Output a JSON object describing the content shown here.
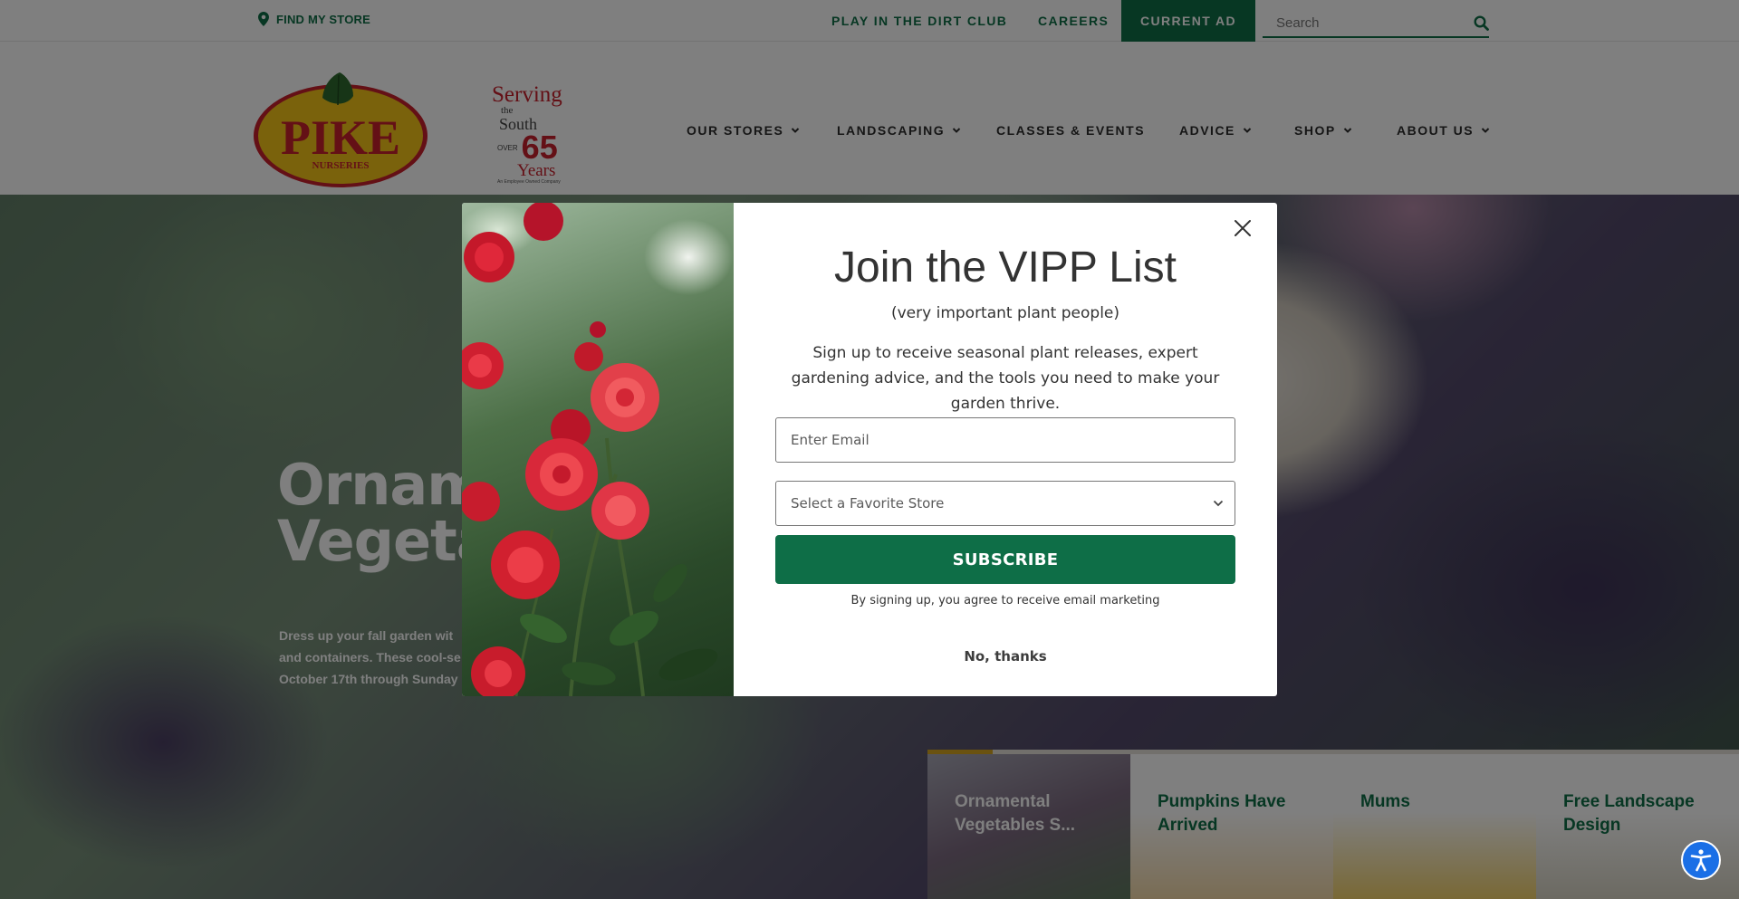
{
  "topbar": {
    "find_store": "FIND MY STORE",
    "links": [
      "PLAY IN THE DIRT CLUB",
      "CAREERS"
    ],
    "current_ad": "CURRENT AD",
    "search_placeholder": "Search"
  },
  "brand": {
    "logo_text": "PIKE",
    "logo_subtext": "NURSERIES",
    "anniversary": {
      "line1": "Serving",
      "line2": "the",
      "line3": "South",
      "over": "OVER",
      "number": "65",
      "years": "Years",
      "tagline": "An Employee Owned Company"
    }
  },
  "nav": {
    "items": [
      {
        "label": "OUR STORES",
        "dropdown": true
      },
      {
        "label": "LANDSCAPING",
        "dropdown": true
      },
      {
        "label": "CLASSES & EVENTS",
        "dropdown": false
      },
      {
        "label": "ADVICE",
        "dropdown": true
      },
      {
        "label": "SHOP",
        "dropdown": true
      },
      {
        "label": "ABOUT US",
        "dropdown": true
      }
    ]
  },
  "hero": {
    "title_line1": "Ornam",
    "title_line2": "Vegeta",
    "desc_line1": "Dress up your fall garden wit",
    "desc_line2": "and containers. These cool-se",
    "desc_line3": "October 17th through Sunday"
  },
  "tiles": [
    {
      "label": "Ornamental Vegetables S..."
    },
    {
      "label": "Pumpkins Have Arrived"
    },
    {
      "label": "Mums"
    },
    {
      "label": "Free Landscape Design"
    }
  ],
  "modal": {
    "title": "Join the VIPP List",
    "subtitle": "(very important plant people)",
    "description": "Sign up to receive seasonal plant releases, expert gardening advice, and the tools you need to make your garden thrive.",
    "email_placeholder": "Enter Email",
    "store_select": "Select a Favorite Store",
    "subscribe": "SUBSCRIBE",
    "legal": "By signing up, you agree to receive email marketing",
    "no_thanks": "No, thanks"
  },
  "colors": {
    "brand_green": "#0e6e47",
    "accent_gold": "#d5a520",
    "logo_red": "#c8202d",
    "logo_yellow": "#f5c518",
    "a11y_blue": "#1a6fe6"
  },
  "icons": [
    "map-pin-icon",
    "search-icon",
    "chevron-down-icon",
    "close-icon",
    "accessibility-icon"
  ]
}
